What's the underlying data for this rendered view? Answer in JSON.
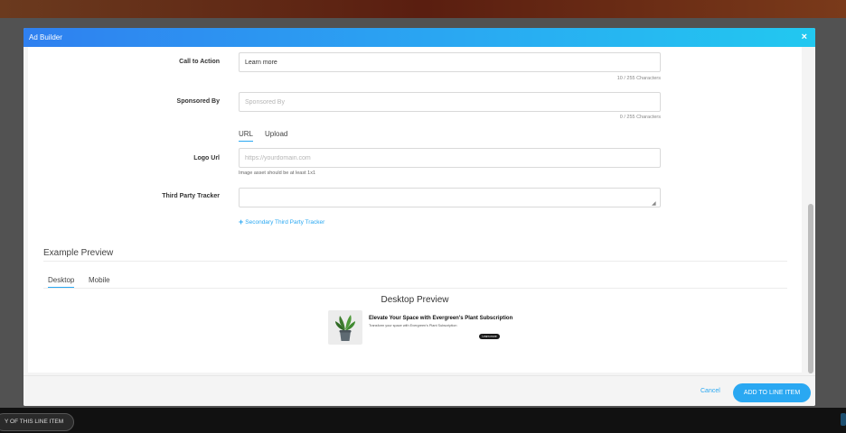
{
  "modal": {
    "title": "Ad Builder",
    "close_icon": "×"
  },
  "form": {
    "call_to_action": {
      "label": "Call to Action",
      "value": "Learn more",
      "char_count": "10 / 255 Characters"
    },
    "sponsored_by": {
      "label": "Sponsored By",
      "placeholder": "Sponsored By",
      "char_count": "0 / 255 Characters"
    },
    "logo_tabs": [
      {
        "label": "URL",
        "active": true
      },
      {
        "label": "Upload",
        "active": false
      }
    ],
    "logo_url": {
      "label": "Logo Url",
      "placeholder": "https://yourdomain.com",
      "helper": "Image asset should be at least 1x1"
    },
    "third_party_tracker": {
      "label": "Third Party Tracker",
      "value": ""
    },
    "secondary_tracker_link": {
      "icon": "+",
      "label": "Secondary Third Party Tracker"
    }
  },
  "preview": {
    "section_title": "Example Preview",
    "tabs": [
      {
        "label": "Desktop",
        "active": true
      },
      {
        "label": "Mobile",
        "active": false
      }
    ],
    "heading": "Desktop Preview",
    "ad": {
      "headline": "Elevate Your Space with Evergreen's Plant Subscription",
      "body": "Transform your space with Evergreen's Plant Subscription",
      "cta": "Learn more",
      "image_icon": "potted-plant-icon"
    }
  },
  "footer": {
    "cancel_label": "Cancel",
    "primary_label": "ADD TO LINE ITEM"
  },
  "background": {
    "bottom_pill_label": "Y OF THIS LINE ITEM"
  },
  "colors": {
    "accent": "#2aa8f2",
    "header_start": "#2f80f0",
    "header_end": "#22c8f0"
  }
}
